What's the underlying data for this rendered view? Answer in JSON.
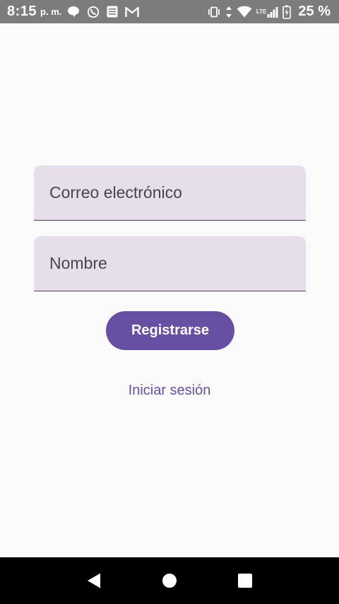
{
  "status_bar": {
    "time": "8:15",
    "ampm": "p. m.",
    "network": "LTE",
    "battery": "25 %"
  },
  "form": {
    "email_placeholder": "Correo electrónico",
    "name_placeholder": "Nombre",
    "register_label": "Registrarse",
    "login_link": "Iniciar sesión"
  },
  "colors": {
    "primary": "#6750a4",
    "field_bg": "#e7deec",
    "background": "#fafafa",
    "status_bar_bg": "#7c7c7c"
  },
  "icons": {
    "status_left": [
      "chat-bubble-icon",
      "whatsapp-icon",
      "news-icon",
      "gmail-icon"
    ],
    "status_right": [
      "vibrate-icon",
      "data-arrows-icon",
      "wifi-icon",
      "signal-icon",
      "battery-charging-icon"
    ],
    "nav": [
      "back-icon",
      "home-icon",
      "recents-icon"
    ]
  }
}
